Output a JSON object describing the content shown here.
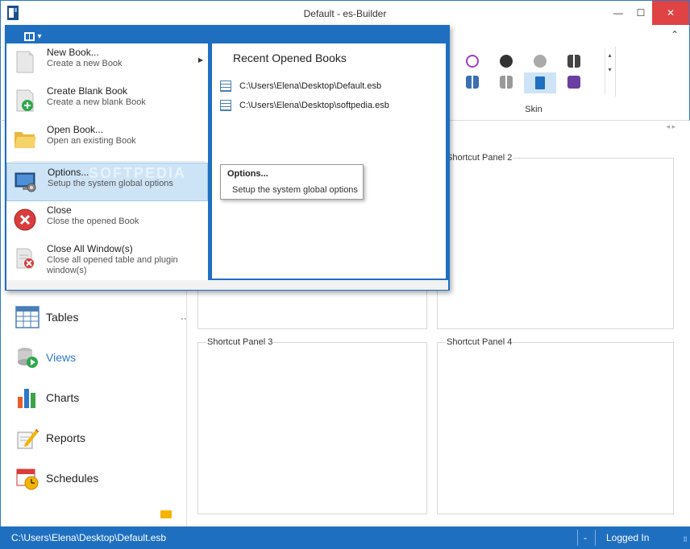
{
  "window": {
    "title": "Default - es-Builder",
    "minimize": "—",
    "maximize": "☐",
    "close": "✕"
  },
  "ribbon": {
    "collapse_icon": "chevron-up-icon",
    "collapse_glyph": "⌃",
    "skin_label": "Skin",
    "gallery_up": "▴",
    "gallery_more": "▾",
    "nav_arrows": "◂ ▸"
  },
  "app_menu": {
    "button_glyph": "▾",
    "items": [
      {
        "title": "New Book...",
        "subtitle": "Create a new Book",
        "icon": "blank-page-icon",
        "has_submenu": true,
        "arrow": "▶"
      },
      {
        "title": "Create Blank Book",
        "subtitle": "Create a new blank Book",
        "icon": "page-add-icon"
      },
      {
        "title": "Open Book...",
        "subtitle": "Open an existing Book",
        "icon": "folder-open-icon"
      },
      {
        "title": "Options...",
        "subtitle": "Setup the system global options",
        "icon": "options-monitor-icon",
        "highlighted": true
      },
      {
        "title": "Close",
        "subtitle": "Close the opened Book",
        "icon": "close-circle-icon"
      },
      {
        "title": "Close All Window(s)",
        "subtitle": "Close all opened table and plugin window(s)",
        "icon": "close-all-windows-icon"
      }
    ],
    "recent": {
      "title": "Recent Opened Books",
      "items": [
        "C:\\Users\\Elena\\Desktop\\Default.esb",
        "C:\\Users\\Elena\\Desktop\\softpedia.esb"
      ]
    },
    "watermark": "SOFTPEDIA"
  },
  "tooltip": {
    "title": "Options...",
    "text": "Setup the system global options"
  },
  "nav": {
    "items": [
      {
        "label": "Tables",
        "icon": "table-icon"
      },
      {
        "label": "Views",
        "icon": "views-play-icon",
        "active": true
      },
      {
        "label": "Charts",
        "icon": "bar-chart-icon"
      },
      {
        "label": "Reports",
        "icon": "report-pencil-icon"
      },
      {
        "label": "Schedules",
        "icon": "calendar-clock-icon"
      }
    ],
    "options_glyph": "⋮"
  },
  "shortcut_panels": [
    {
      "title": ""
    },
    {
      "title": "Shortcut Panel 2"
    },
    {
      "title": "Shortcut Panel 3"
    },
    {
      "title": "Shortcut Panel 4"
    }
  ],
  "status": {
    "path": "C:\\Users\\Elena\\Desktop\\Default.esb",
    "dash": "-",
    "login": "Logged In",
    "grip": "⠿"
  },
  "colors": {
    "accent": "#1f6fc1",
    "highlight": "#cde4f7",
    "close_red": "#e04343",
    "views_active": "#2b79c8"
  }
}
